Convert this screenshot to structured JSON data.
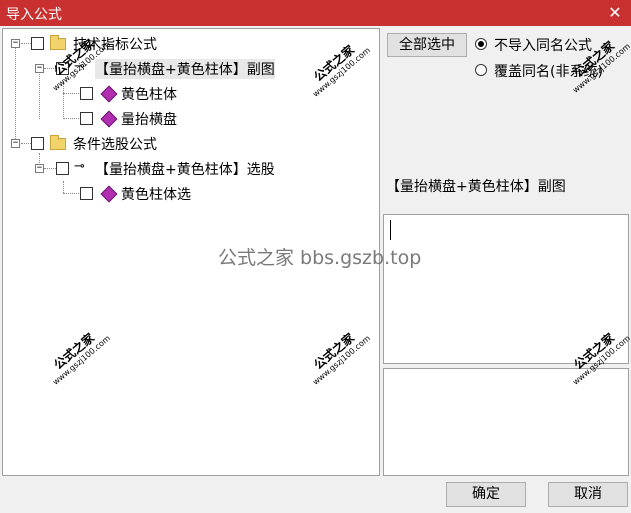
{
  "window": {
    "title": "导入公式"
  },
  "tree": {
    "nodes": [
      {
        "label": "技术指标公式"
      },
      {
        "label": "【量抬横盘+黄色柱体】副图"
      },
      {
        "label": "黄色柱体"
      },
      {
        "label": "量抬横盘"
      },
      {
        "label": "条件选股公式"
      },
      {
        "label": "【量抬横盘+黄色柱体】选股"
      },
      {
        "label": "黄色柱体选"
      }
    ]
  },
  "right": {
    "select_all_label": "全部选中",
    "radio_options": [
      {
        "label": "不导入同名公式",
        "selected": true
      },
      {
        "label": "覆盖同名(非系统)",
        "selected": false
      }
    ],
    "selected_formula": "【量抬横盘+黄色柱体】副图"
  },
  "footer": {
    "ok_label": "确定",
    "cancel_label": "取消"
  },
  "watermark": {
    "brand": "公式之家",
    "url": "www.gszj100.com",
    "center_text": "公式之家 bbs.gszb.top"
  }
}
